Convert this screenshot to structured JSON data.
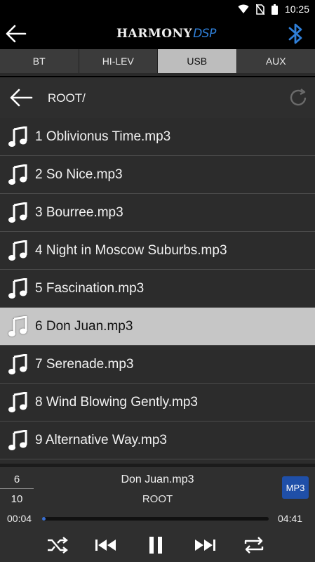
{
  "status_bar": {
    "time": "10:25",
    "icons": [
      "wifi-icon",
      "no-sim-icon",
      "battery-icon"
    ]
  },
  "header": {
    "logo_main": "HARMONY",
    "logo_accent": "DSP",
    "icons": [
      "back-arrow-icon",
      "bluetooth-icon"
    ]
  },
  "tabs": [
    {
      "label": "BT",
      "active": false
    },
    {
      "label": "HI-LEV",
      "active": false
    },
    {
      "label": "USB",
      "active": true
    },
    {
      "label": "AUX",
      "active": false
    }
  ],
  "browser": {
    "path": "ROOT/",
    "icons": [
      "back-arrow-icon",
      "refresh-icon"
    ]
  },
  "files": [
    {
      "name": "1 Oblivionus Time.mp3",
      "selected": false
    },
    {
      "name": "2 So Nice.mp3",
      "selected": false
    },
    {
      "name": "3 Bourree.mp3",
      "selected": false
    },
    {
      "name": "4 Night in Moscow Suburbs.mp3",
      "selected": false
    },
    {
      "name": "5 Fascination.mp3",
      "selected": false
    },
    {
      "name": "6 Don Juan.mp3",
      "selected": true
    },
    {
      "name": "7 Serenade.mp3",
      "selected": false
    },
    {
      "name": "8 Wind Blowing Gently.mp3",
      "selected": false
    },
    {
      "name": "9 Alternative Way.mp3",
      "selected": false
    }
  ],
  "player": {
    "current_index": "6",
    "total": "10",
    "title": "Don Juan.mp3",
    "folder": "ROOT",
    "format": "MP3",
    "elapsed": "00:04",
    "duration": "04:41",
    "progress": 0.014,
    "controls": [
      "shuffle-icon",
      "previous-icon",
      "pause-icon",
      "next-icon",
      "repeat-icon"
    ]
  },
  "colors": {
    "accent": "#2f7fd8",
    "format_badge": "#1f4fa8",
    "selected_row": "#c6c6c6",
    "active_tab": "#bdbdbd"
  }
}
